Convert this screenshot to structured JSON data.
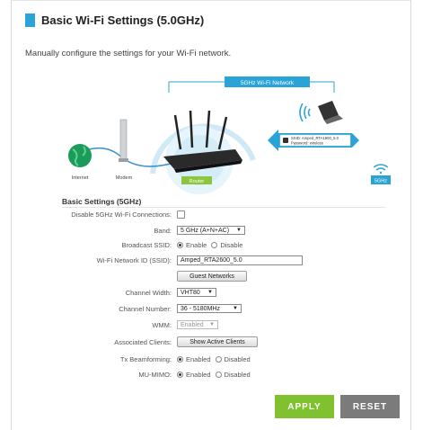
{
  "header": {
    "title": "Basic Wi-Fi Settings (5.0GHz)"
  },
  "description": "Manually configure the settings for your Wi-Fi network.",
  "diagram": {
    "network_banner": "5GHz Wi-Fi Network",
    "internet_label": "Internet",
    "modem_label": "Modem",
    "router_label": "Router",
    "ssid_line": "SSID: Amped_RTA1900_5.0",
    "password_line": "Password: wireless",
    "band_badge": "5GHz"
  },
  "section": {
    "title": "Basic Settings (5GHz)"
  },
  "fields": {
    "disable_label": "Disable 5GHz Wi-Fi Connections:",
    "band_label": "Band:",
    "band_value": "5 GHz (A+N+AC)",
    "broadcast_label": "Broadcast SSID:",
    "enable_label": "Enable",
    "disable_opt_label": "Disable",
    "ssid_label": "Wi-Fi Network ID (SSID):",
    "ssid_value": "Amped_RTA2600_5.0",
    "guest_button": "Guest Networks",
    "channel_width_label": "Channel Width:",
    "channel_width_value": "VHT80",
    "channel_number_label": "Channel Number:",
    "channel_number_value": "36 - 5180MHz",
    "wmm_label": "WMM:",
    "wmm_value": "Enabled",
    "assoc_label": "Associated Clients:",
    "assoc_button": "Show Active Clients",
    "tx_label": "Tx Beamforming:",
    "mumimo_label": "MU-MIMO:",
    "enabled_label": "Enabled",
    "disabled_label": "Disabled"
  },
  "actions": {
    "apply": "APPLY",
    "reset": "RESET"
  },
  "colors": {
    "accent": "#2aa3d8",
    "apply": "#7fc12f",
    "reset": "#7b7b7b",
    "router_label_bg": "#8cc63f"
  }
}
